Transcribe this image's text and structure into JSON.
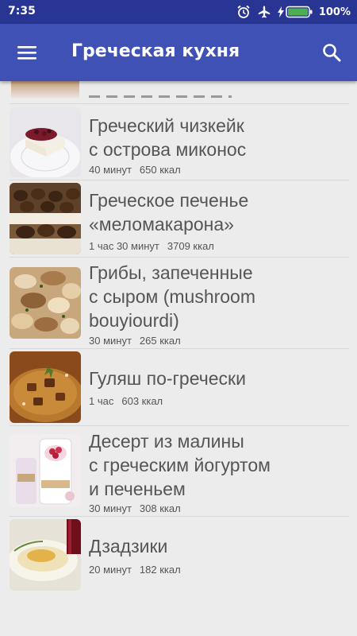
{
  "status": {
    "time": "7:35",
    "battery": "100%"
  },
  "appbar": {
    "title": "Греческая кухня"
  },
  "recipes": [
    {
      "title": "Греческий чизкейк\nс острова миконос",
      "time": "40 минут",
      "kcal": "650 ккал"
    },
    {
      "title": "Греческое печенье\n«меломакарона»",
      "time": "1 час 30 минут",
      "kcal": "3709 ккал"
    },
    {
      "title": "Грибы, запеченные\nс сыром (mushroom\nbouyiourdi)",
      "time": "30 минут",
      "kcal": "265 ккал"
    },
    {
      "title": "Гуляш по-гречески",
      "time": "1 час",
      "kcal": "603 ккал"
    },
    {
      "title": "Десерт из малины\nс греческим йогуртом\nи печеньем",
      "time": "30 минут",
      "kcal": "308 ккал"
    },
    {
      "title": "Дзадзики",
      "time": "20 минут",
      "kcal": "182 ккал"
    }
  ]
}
